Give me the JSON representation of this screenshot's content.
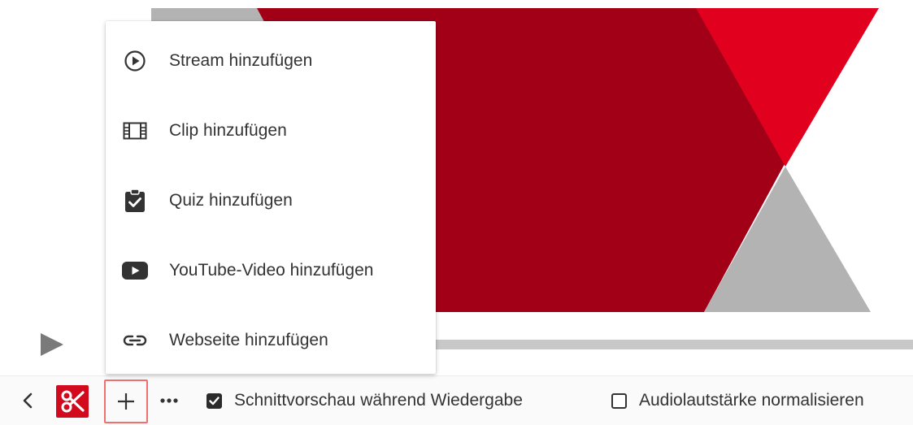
{
  "video": {
    "colors": {
      "dark_red": "#a10017",
      "bright_red": "#e1001e",
      "gray": "#b4b3b3"
    }
  },
  "player": {
    "play_icon": "play-triangle-icon"
  },
  "menu": {
    "items": [
      {
        "label": "Stream hinzufügen",
        "icon": "play-circle-icon"
      },
      {
        "label": "Clip hinzufügen",
        "icon": "film-strip-icon"
      },
      {
        "label": "Quiz hinzufügen",
        "icon": "clipboard-check-icon"
      },
      {
        "label": "YouTube-Video hinzufügen",
        "icon": "youtube-icon"
      },
      {
        "label": "Webseite hinzufügen",
        "icon": "link-icon"
      }
    ]
  },
  "toolbar": {
    "back_icon": "chevron-left-icon",
    "cut_icon": "scissors-icon",
    "add_icon": "plus-icon",
    "more_icon": "more-horizontal-icon",
    "cut_preview": {
      "label": "Schnittvorschau während Wiedergabe",
      "checked": true
    },
    "normalize_audio": {
      "label": "Audiolautstärke normalisieren",
      "checked": false
    },
    "accent_color": "#d20a1e"
  }
}
